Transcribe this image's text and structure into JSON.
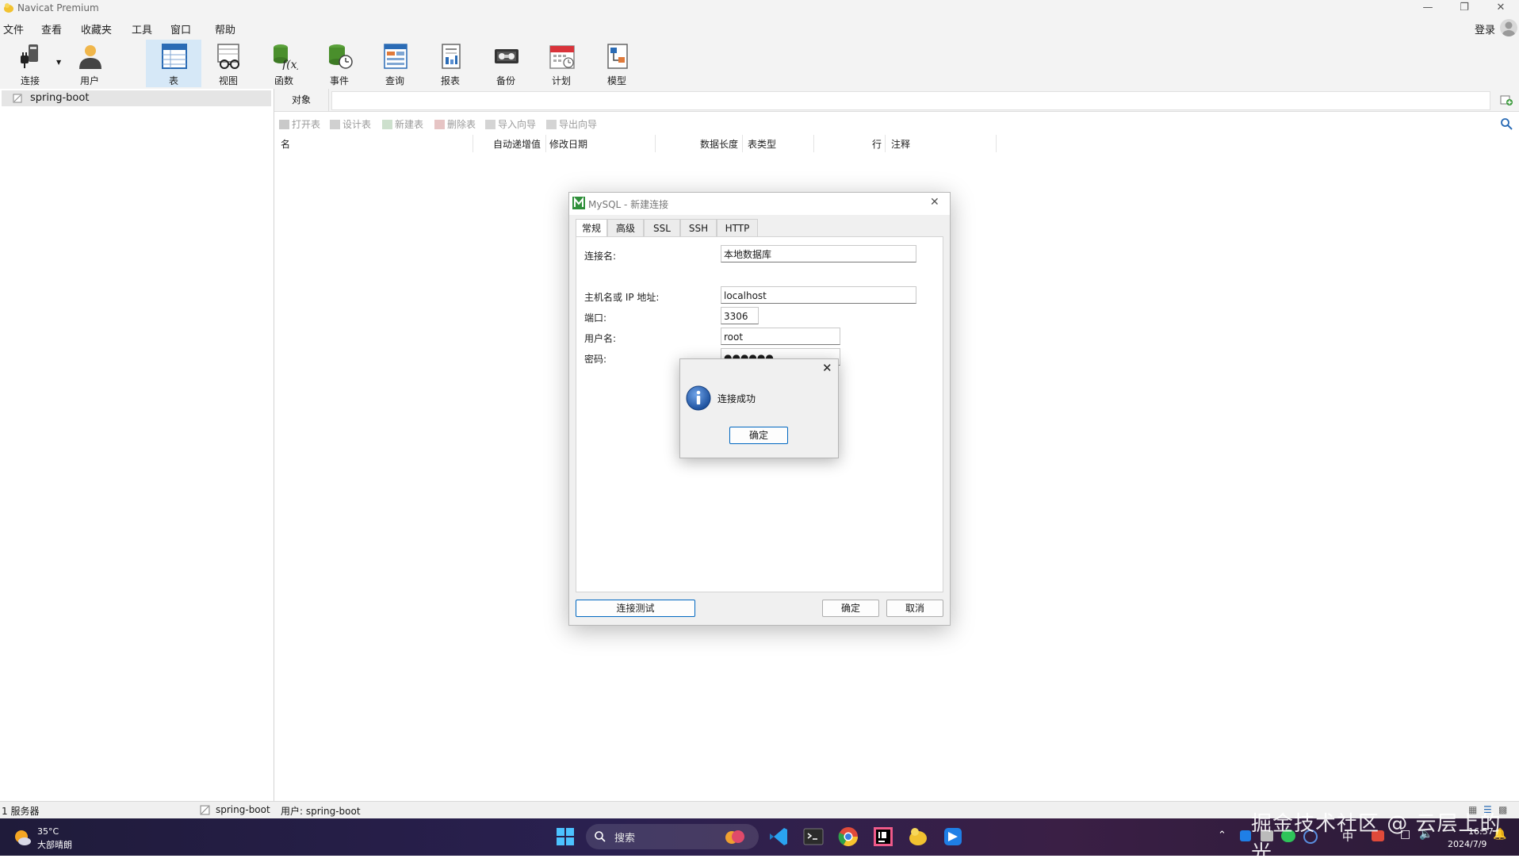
{
  "app": {
    "title": "Navicat Premium"
  },
  "menubar": {
    "items": [
      "文件",
      "查看",
      "收藏夹",
      "工具",
      "窗口",
      "帮助"
    ],
    "login": "登录"
  },
  "toolbar": {
    "items": [
      {
        "label": "连接",
        "icon": "connection-plug-icon"
      },
      {
        "label": "用户",
        "icon": "user-icon"
      },
      {
        "label": "表",
        "icon": "table-icon",
        "active": true
      },
      {
        "label": "视图",
        "icon": "view-glasses-icon"
      },
      {
        "label": "函数",
        "icon": "function-icon"
      },
      {
        "label": "事件",
        "icon": "event-clock-icon"
      },
      {
        "label": "查询",
        "icon": "query-icon"
      },
      {
        "label": "报表",
        "icon": "report-icon"
      },
      {
        "label": "备份",
        "icon": "backup-icon"
      },
      {
        "label": "计划",
        "icon": "schedule-calendar-icon"
      },
      {
        "label": "模型",
        "icon": "model-icon"
      }
    ]
  },
  "tree": {
    "items": [
      {
        "label": "spring-boot"
      }
    ]
  },
  "objects": {
    "tab": "对象",
    "actions": [
      "打开表",
      "设计表",
      "新建表",
      "删除表",
      "导入向导",
      "导出向导"
    ],
    "columns": [
      "名",
      "自动递增值",
      "修改日期",
      "数据长度",
      "表类型",
      "行",
      "注释"
    ]
  },
  "dialog": {
    "title": "MySQL - 新建连接",
    "tabs": [
      "常规",
      "高级",
      "SSL",
      "SSH",
      "HTTP"
    ],
    "fields": {
      "conn_name_label": "连接名:",
      "conn_name_value": "本地数据库",
      "host_label": "主机名或 IP 地址:",
      "host_value": "localhost",
      "port_label": "端口:",
      "port_value": "3306",
      "user_label": "用户名:",
      "user_value": "root",
      "password_label": "密码:",
      "password_value": "●●●●●●"
    },
    "buttons": {
      "test": "连接测试",
      "ok": "确定",
      "cancel": "取消"
    }
  },
  "message": {
    "text": "连接成功",
    "ok": "确定"
  },
  "statusbar": {
    "servers": "1 服务器",
    "connection": "spring-boot",
    "user": "用户: spring-boot"
  },
  "taskbar": {
    "weather_temp": "35°C",
    "weather_desc": "大部晴朗",
    "search": "搜索",
    "ime": "中",
    "time": "16:57",
    "date": "2024/7/9"
  },
  "watermark": "掘金技术社区 @ 云层上的光",
  "colors": {
    "accent": "#0067c0",
    "toolbar_active": "#d6e8f7",
    "taskbar": "#2a2050"
  }
}
